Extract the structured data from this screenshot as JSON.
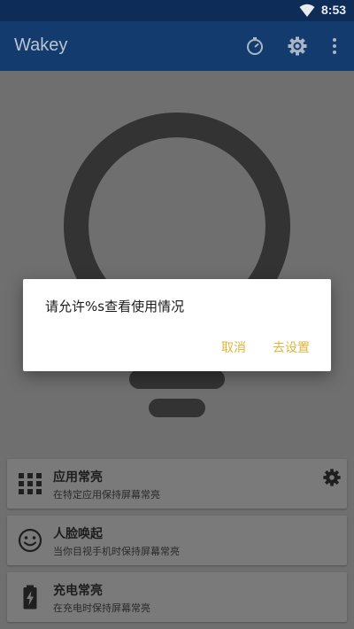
{
  "status_bar": {
    "time": "8:53",
    "icons": [
      "wifi-icon"
    ]
  },
  "app_bar": {
    "title": "Wakey",
    "actions": [
      "timer-icon",
      "settings-icon",
      "more-vert-icon"
    ]
  },
  "main": {
    "illustration": "lightbulb-icon"
  },
  "cards": [
    {
      "title": "应用常亮",
      "subtitle": "在特定应用保持屏幕常亮",
      "icon": "apps-grid-icon",
      "has_settings": true
    },
    {
      "title": "人脸唤起",
      "subtitle": "当你目视手机时保持屏幕常亮",
      "icon": "smiley-face-icon"
    },
    {
      "title": "充电常亮",
      "subtitle": "在充电时保持屏幕常亮",
      "icon": "battery-charging-icon"
    }
  ],
  "dialog": {
    "message": "请允许%s查看使用情况",
    "cancel_label": "取消",
    "confirm_label": "去设置"
  },
  "colors": {
    "status_bar": "#0d2c57",
    "app_bar": "#133b6e",
    "background": "#6f6f6f",
    "card": "#7a7a7a",
    "dialog_button": "#e0b43a",
    "bulb": "#333333"
  }
}
